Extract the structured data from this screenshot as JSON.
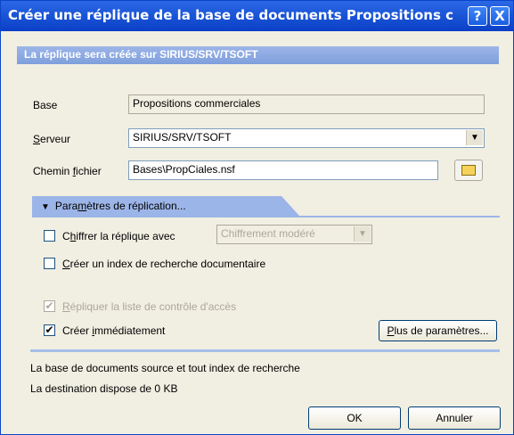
{
  "window": {
    "title": "Créer une réplique de la base de documents Propositions comı",
    "help_label": "?",
    "close_label": "X"
  },
  "header": {
    "text": "La réplique sera créée sur SIRIUS/SRV/TSOFT"
  },
  "form": {
    "base_label": "Base",
    "base_value": "Propositions commerciales",
    "server_label": "Serveur",
    "server_value": "SIRIUS/SRV/TSOFT",
    "path_label": "Chemin fichier",
    "path_value": "Bases\\PropCiales.nsf"
  },
  "replication": {
    "section_label": "Paramètres de réplication...",
    "encrypt_label": "Chiffrer la réplique avec",
    "encrypt_checked": false,
    "encrypt_option": "Chiffrement modéré",
    "index_label": "Créer un index de recherche documentaire",
    "index_checked": false,
    "acl_label": "Répliquer la liste de contrôle d'accès",
    "acl_checked": true,
    "acl_enabled": false,
    "immediate_label": "Créer immédiatement",
    "immediate_checked": true,
    "more_button": "Plus de paramètres..."
  },
  "info": {
    "line1": "La base de documents source et tout index de recherche",
    "line2": "La destination dispose de 0 KB"
  },
  "buttons": {
    "ok": "OK",
    "cancel": "Annuler"
  },
  "colors": {
    "titlebar": "#0a3fc6",
    "band": "#9cb5e8",
    "background": "#f1efe2"
  }
}
